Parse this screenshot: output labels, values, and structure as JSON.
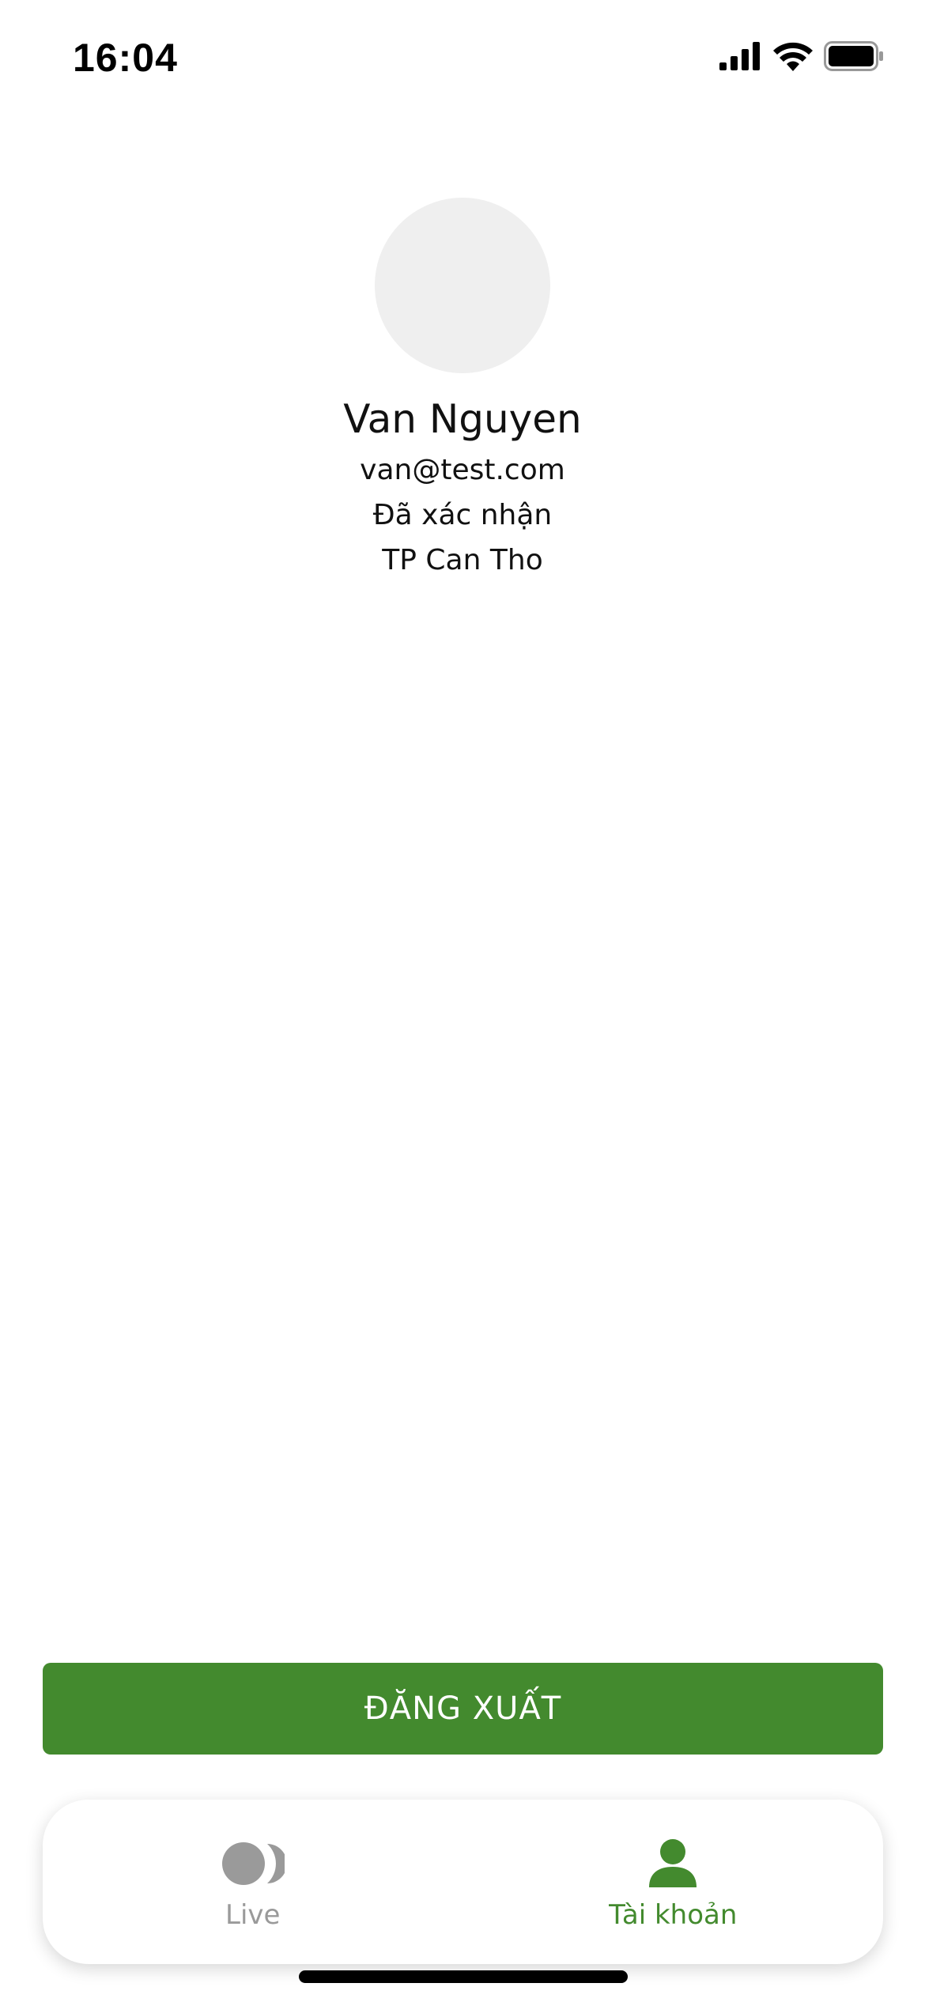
{
  "status_bar": {
    "time": "16:04",
    "icons": [
      "signal-icon",
      "wifi-icon",
      "battery-icon"
    ]
  },
  "profile": {
    "avatar": "avatar-placeholder",
    "name": "Van Nguyen",
    "email": "van@test.com",
    "verification_status": "Đã xác nhận",
    "city": "TP Can Tho"
  },
  "actions": {
    "logout_label": "ĐĂNG XUẤT"
  },
  "tab_bar": {
    "tabs": [
      {
        "label": "Live",
        "icon": "live-icon",
        "active": false
      },
      {
        "label": "Tài khoản",
        "icon": "person-icon",
        "active": true
      }
    ]
  },
  "colors": {
    "accent": "#438a2e",
    "inactive": "#9a9a9a",
    "avatar_bg": "#efefef"
  }
}
